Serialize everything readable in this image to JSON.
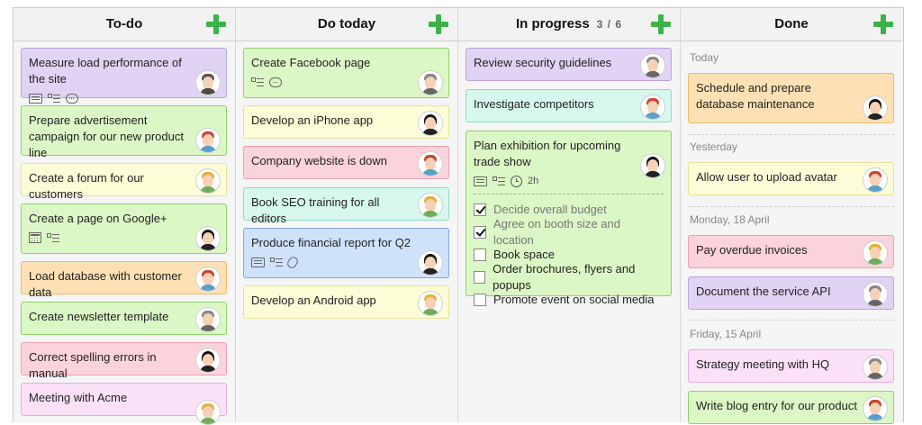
{
  "columns": [
    {
      "title": "To-do",
      "count": ""
    },
    {
      "title": "Do today",
      "count": ""
    },
    {
      "title": "In progress",
      "count": "3 / 6"
    },
    {
      "title": "Done",
      "count": ""
    }
  ],
  "todo": [
    "Measure load performance of the site",
    "Prepare advertisement campaign for our new product line",
    "Create a forum for our customers",
    "Create a page on Google+",
    "Load database with customer data",
    "Create newsletter template",
    "Correct spelling errors in manual",
    "Meeting with Acme"
  ],
  "today": [
    "Create Facebook page",
    "Develop an iPhone app",
    "Company website is down",
    "Book SEO training for all editors",
    "Produce financial report for Q2",
    "Develop an Android app"
  ],
  "progress": {
    "cards": [
      "Review security guidelines",
      "Investigate competitors",
      "Plan exhibition for upcoming trade show"
    ],
    "estimate": "2h",
    "checklist": [
      {
        "label": "Decide overall budget",
        "checked": true
      },
      {
        "label": "Agree on booth size and location",
        "checked": true
      },
      {
        "label": "Book space",
        "checked": false
      },
      {
        "label": "Order brochures, flyers and popups",
        "checked": false
      },
      {
        "label": "Promote event on social media",
        "checked": false
      }
    ]
  },
  "done": {
    "groups": [
      "Today",
      "Yesterday",
      "Monday, 18 April",
      "Friday, 15 April"
    ],
    "cards": [
      "Schedule and prepare database maintenance",
      "Allow user to upload avatar",
      "Pay overdue invoices",
      "Document the service API",
      "Strategy meeting with HQ",
      "Write blog entry for our product"
    ]
  },
  "icons": [
    "note-icon",
    "checklist-icon",
    "comment-icon",
    "calendar-icon",
    "attachment-icon",
    "clock-icon",
    "add-icon"
  ]
}
